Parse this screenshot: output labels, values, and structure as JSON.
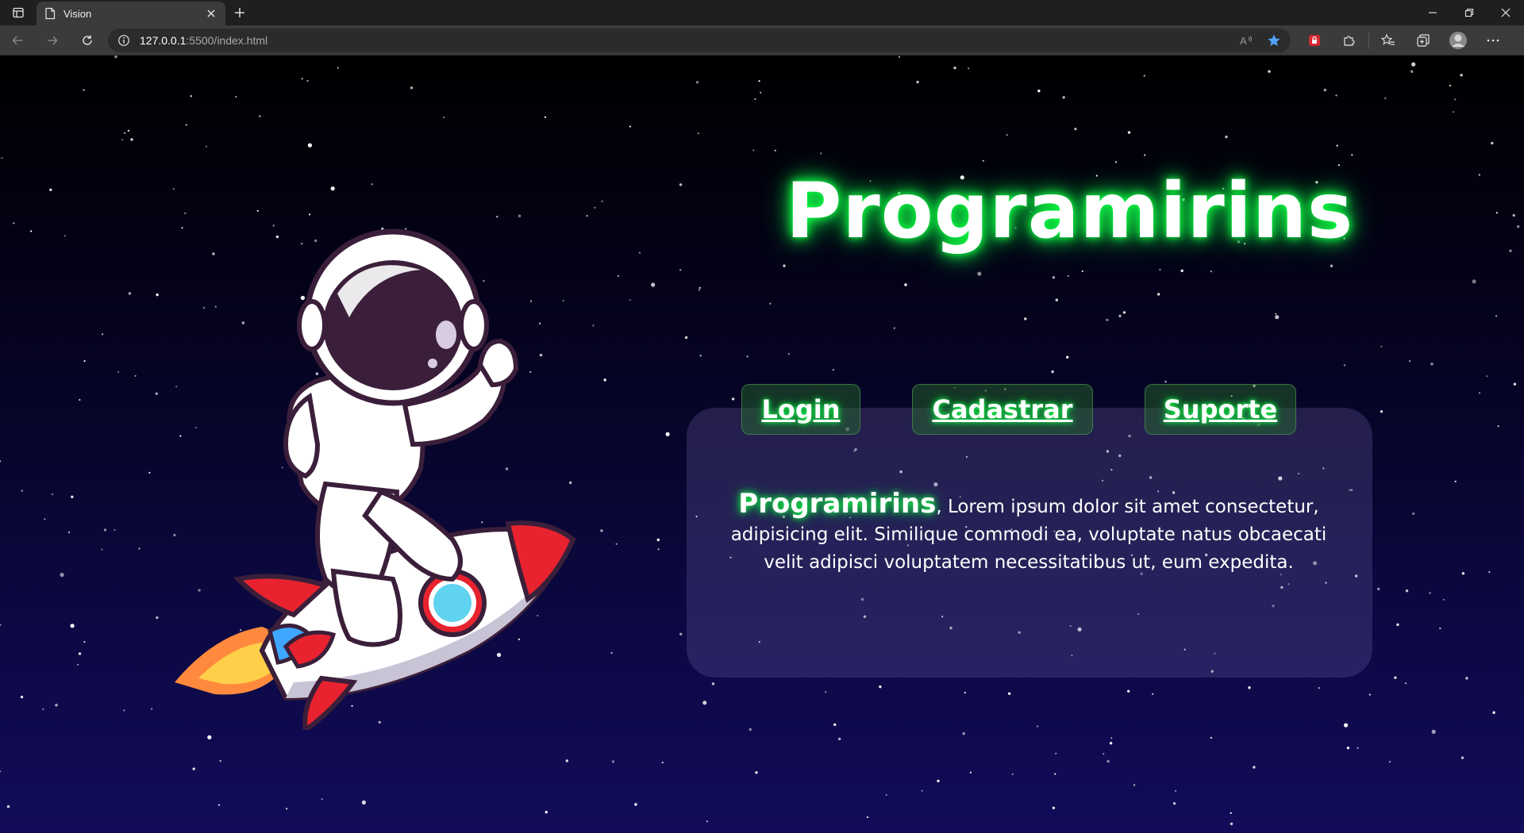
{
  "browser": {
    "tab_title": "Vision",
    "url_host": "127.0.0.1",
    "url_rest": ":5500/index.html"
  },
  "page": {
    "title": "Programirins",
    "nav": {
      "login": "Login",
      "cadastrar": "Cadastrar",
      "suporte": "Suporte"
    },
    "info": {
      "brand": "Programirins",
      "text": ", Lorem ipsum dolor sit amet consectetur, adipisicing elit. Similique commodi ea, voluptate natus obcaecati velit adipisci voluptatem necessitatibus ut, eum expedita."
    },
    "colors": {
      "glow": "#1cff4e",
      "panel": "#6e64aa",
      "nav_bg": "#286e28"
    },
    "illustration": "astronaut-riding-rocket"
  }
}
